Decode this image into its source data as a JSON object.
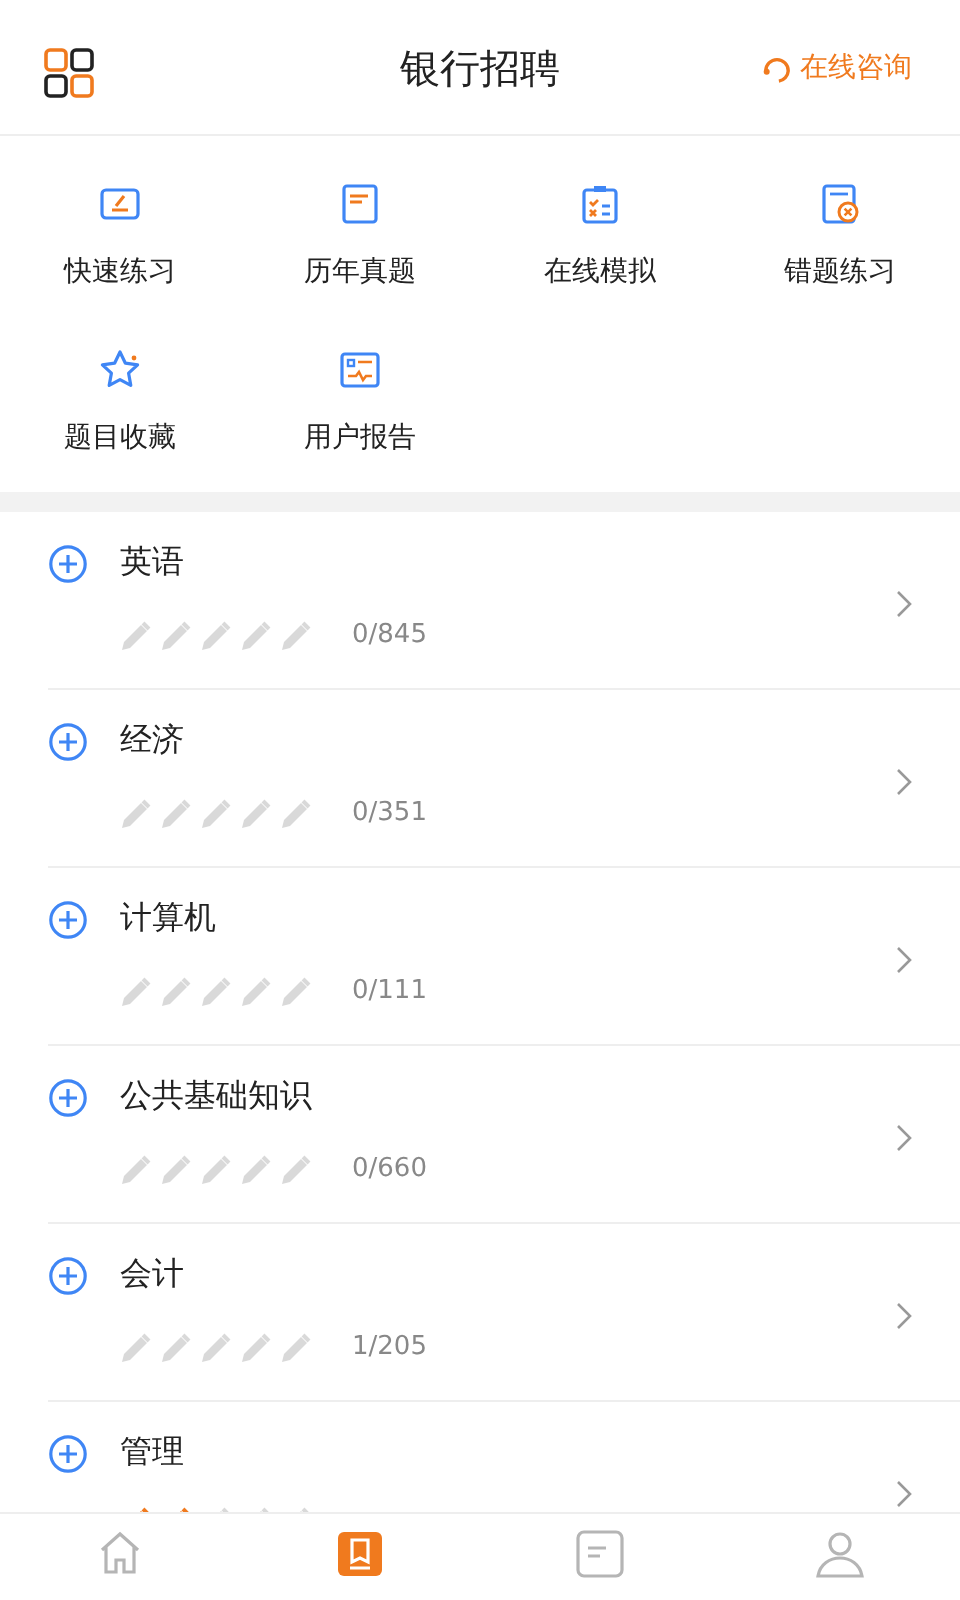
{
  "header": {
    "title": "银行招聘",
    "consult": "在线咨询"
  },
  "shortcuts": [
    {
      "label": "快速练习",
      "kind": "practice"
    },
    {
      "label": "历年真题",
      "kind": "book"
    },
    {
      "label": "在线模拟",
      "kind": "clipboard"
    },
    {
      "label": "错题练习",
      "kind": "wrong"
    },
    {
      "label": "题目收藏",
      "kind": "star"
    },
    {
      "label": "用户报告",
      "kind": "report"
    }
  ],
  "subjects": [
    {
      "name": "英语",
      "stars": 0,
      "count": "0/845"
    },
    {
      "name": "经济",
      "stars": 0,
      "count": "0/351"
    },
    {
      "name": "计算机",
      "stars": 0,
      "count": "0/111"
    },
    {
      "name": "公共基础知识",
      "stars": 0,
      "count": "0/660"
    },
    {
      "name": "会计",
      "stars": 0,
      "count": "1/205"
    },
    {
      "name": "管理",
      "stars": 2
    }
  ],
  "tabbar": [
    {
      "kind": "home",
      "selected": false
    },
    {
      "kind": "bank",
      "selected": true
    },
    {
      "kind": "course",
      "selected": false
    },
    {
      "kind": "me",
      "selected": false
    }
  ]
}
